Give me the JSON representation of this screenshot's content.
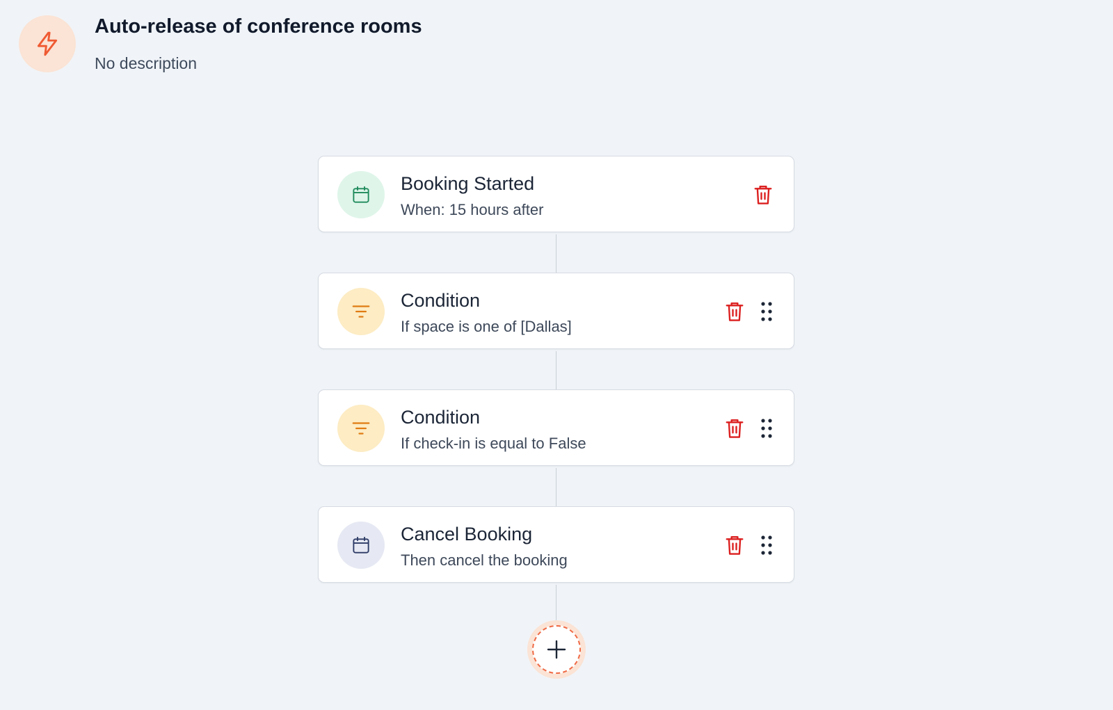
{
  "header": {
    "title": "Auto-release of conference rooms",
    "description": "No description",
    "icon": "lightning-bolt-icon",
    "icon_color": "#ef5a32",
    "icon_bg": "#fbe3d5"
  },
  "steps": [
    {
      "title": "Booking Started",
      "subtitle": "When: 15 hours after",
      "icon": "calendar-icon",
      "icon_color": "#1f8a5b",
      "icon_bg": "#dff5ea",
      "deletable": true,
      "draggable": false
    },
    {
      "title": "Condition",
      "subtitle": "If space is one of [Dallas]",
      "icon": "filter-icon",
      "icon_color": "#e07b12",
      "icon_bg": "#fdecc4",
      "deletable": true,
      "draggable": true
    },
    {
      "title": "Condition",
      "subtitle": "If check-in is equal to False",
      "icon": "filter-icon",
      "icon_color": "#e07b12",
      "icon_bg": "#fdecc4",
      "deletable": true,
      "draggable": true
    },
    {
      "title": "Cancel Booking",
      "subtitle": "Then cancel the booking",
      "icon": "calendar-icon",
      "icon_color": "#2c3a66",
      "icon_bg": "#e6e9f3",
      "deletable": true,
      "draggable": true
    }
  ],
  "actions": {
    "delete_icon": "trash-icon",
    "delete_color": "#dc1f1f",
    "drag_icon": "drag-handle-icon",
    "add_icon": "plus-icon",
    "add_accent": "#ef6a45"
  }
}
